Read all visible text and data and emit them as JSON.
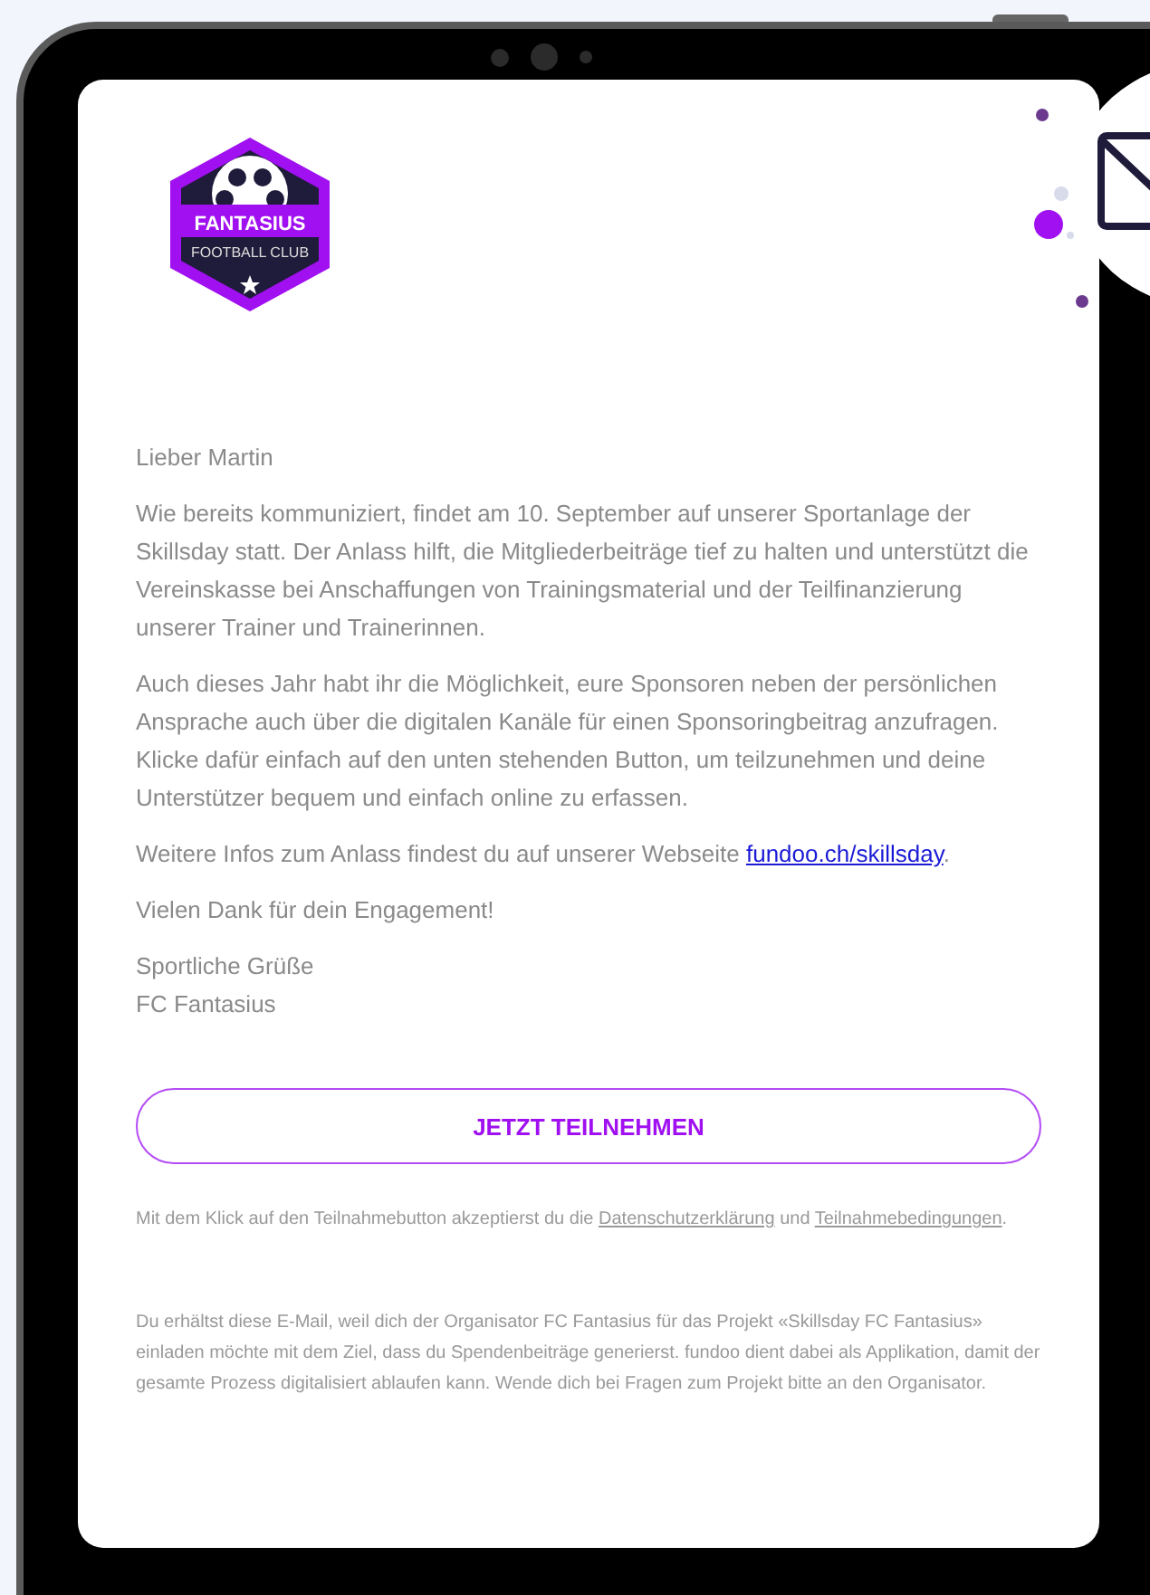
{
  "logo": {
    "name": "FANTASIUS",
    "subtitle": "FOOTBALL CLUB"
  },
  "email": {
    "paragraphs": [
      [
        {
          "kind": "text",
          "text": "Lieber Martin"
        }
      ],
      [
        {
          "kind": "text",
          "text": "Wie bereits kommuniziert, findet am 10. September auf unserer Sportanlage der Skillsday statt. Der Anlass hilft, die Mitgliederbeiträge tief zu halten und unterstützt die Vereinskasse bei Anschaffungen von Trainingsmaterial und der Teilfinanzierung unserer Trainer und Trainerinnen."
        }
      ],
      [
        {
          "kind": "text",
          "text": "Auch dieses Jahr habt ihr die Möglichkeit, eure Sponsoren neben der persönlichen Ansprache auch über die digitalen Kanäle für einen Sponsoringbeitrag anzufragen. Klicke dafür einfach auf den unten stehenden Button, um teilzunehmen und deine Unterstützer bequem und einfach online zu erfassen."
        }
      ],
      [
        {
          "kind": "text",
          "text": "Weitere Infos zum Anlass findest du auf unserer Webseite "
        },
        {
          "kind": "link",
          "text": "fundoo.ch/skillsday"
        },
        {
          "kind": "text",
          "text": "."
        }
      ],
      [
        {
          "kind": "text",
          "text": "Vielen Dank für dein Engagement!"
        }
      ]
    ],
    "signature": [
      "Sportliche Grüße",
      "FC Fantasius"
    ],
    "button": "JETZT TEILNEHMEN",
    "consent": [
      {
        "kind": "text",
        "text": "Mit dem Klick auf den Teilnahmebutton akzeptierst du die "
      },
      {
        "kind": "link",
        "text": "Datenschutzerklärung"
      },
      {
        "kind": "text",
        "text": " und "
      },
      {
        "kind": "link",
        "text": "Teilnahmebedingungen"
      },
      {
        "kind": "text",
        "text": "."
      }
    ],
    "footer": "Du erhältst diese E-Mail, weil dich der Organisator FC Fantasius für das Projekt «Skillsday FC Fantasius» einladen möchte mit dem Ziel, dass du Spendenbeiträge generierst. fundoo dient dabei als Applikation, damit der gesamte Prozess digitalisiert ablaufen kann. Wende dich bei Fragen zum Projekt bitte an den Organisator."
  }
}
